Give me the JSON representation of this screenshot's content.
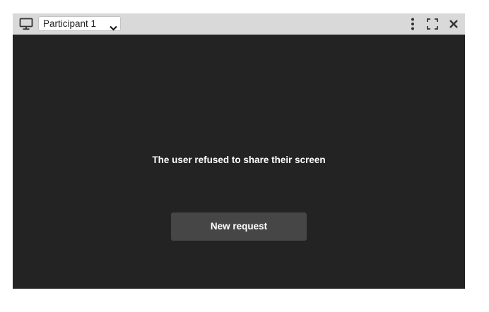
{
  "toolbar": {
    "participant_select": {
      "selected": "Participant 1"
    },
    "icons": {
      "screen": "monitor-icon",
      "more": "more-vertical-icon",
      "fullscreen": "fullscreen-icon",
      "close": "close-icon"
    }
  },
  "main": {
    "message": "The user refused to share their screen",
    "new_request_label": "New request"
  },
  "colors": {
    "toolbar_bg": "#d9d9d9",
    "panel_bg": "#232323",
    "button_bg": "#464646",
    "text_light": "#ffffff"
  }
}
